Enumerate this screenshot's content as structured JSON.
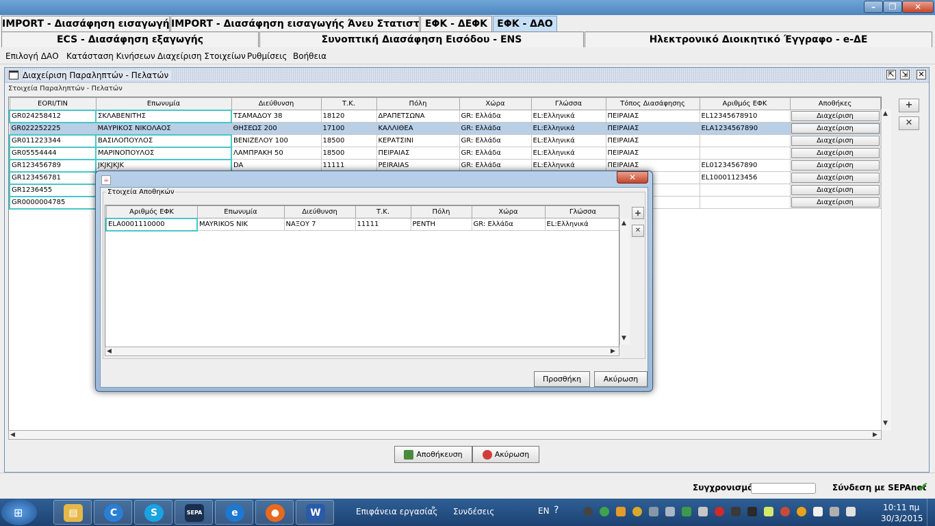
{
  "tabs_row1": [
    {
      "label": "IMPORT - Διασάφηση εισαγωγής",
      "active": false
    },
    {
      "label": "IMPORT - Διασάφηση εισαγωγής Άνευ Στατιστικής",
      "active": false
    },
    {
      "label": "ΕΦΚ - ΔΕΦΚ",
      "active": false
    },
    {
      "label": "ΕΦΚ - ΔΑΟ",
      "active": true
    }
  ],
  "tabs_row2": [
    {
      "label": "ECS - Διασάφηση εξαγωγής"
    },
    {
      "label": "Συνοπτική Διασάφηση Εισόδου - ENS"
    },
    {
      "label": "Ηλεκτρονικό Διοικητικό Έγγραφο - e-ΔΕ"
    }
  ],
  "menu": [
    "Επιλογή ΔΑΟ",
    "Κατάσταση Κινήσεων",
    "Διαχείριση Στοιχείων",
    "Ρυθμίσεις",
    "Βοήθεια"
  ],
  "frame": {
    "title": "Διαχείριση Παραληπτών - Πελατών",
    "group_label": "Στοιχεία Παραληπτών - Πελατών"
  },
  "table": {
    "headers": [
      "EORI/TIN",
      "Επωνυμία",
      "Διεύθυνση",
      "Τ.Κ.",
      "Πόλη",
      "Χώρα",
      "Γλώσσα",
      "Τόπος Διασάφησης",
      "Αριθμός ΕΦΚ",
      "Αποθήκες"
    ],
    "button_label": "Διαχείριση",
    "rows": [
      [
        "GR024258412",
        "ΣΚΛΑΒΕΝΙΤΗΣ",
        "ΤΣΑΜΑΔΟΥ 38",
        "18120",
        "ΔΡΑΠΕΤΣΩΝΑ",
        "GR: Ελλάδα",
        "EL:Ελληνικά",
        "ΠΕΙΡΑΙΑΣ",
        "EL12345678910"
      ],
      [
        "GR022252225",
        "ΜΑΥΡΙΚΟΣ ΝΙΚΟΛΑΟΣ",
        "ΘΗΣΕΩΣ 200",
        "17100",
        "ΚΑΛΛΙΘΕΑ",
        "GR: Ελλάδα",
        "EL:Ελληνικά",
        "ΠΕΙΡΑΙΑΣ",
        "ELA1234567890"
      ],
      [
        "GR011223344",
        "ΒΑΣΙΛΟΠΟΥΛΟΣ",
        "ΒΕΝΙΖΕΛΟΥ 100",
        "18500",
        "ΚΕΡΑΤΣΙΝΙ",
        "GR: Ελλάδα",
        "EL:Ελληνικά",
        "ΠΕΙΡΑΙΑΣ",
        ""
      ],
      [
        "GR05554444",
        "ΜΑΡΙΝΟΠΟΥΛΟΣ",
        "ΛΑΜΠΡΑΚΗ 50",
        "18500",
        "ΠΕΙΡΑΙΑΣ",
        "GR: Ελλάδα",
        "EL:Ελληνικά",
        "ΠΕΙΡΑΙΑΣ",
        ""
      ],
      [
        "GR123456789",
        "JKJKJKJK",
        "DA",
        "11111",
        "PEIRAIAS",
        "GR: Ελλάδα",
        "EL:Ελληνικά",
        "ΠΕΙΡΑΙΑΣ",
        "EL01234567890"
      ],
      [
        "GR123456781",
        "",
        "",
        "",
        "",
        "",
        "",
        "",
        "EL10001123456"
      ],
      [
        "GR1236455",
        "",
        "",
        "",
        "",
        "",
        "",
        "",
        ""
      ],
      [
        "GR0000004785",
        "",
        "",
        "",
        "",
        "",
        "",
        "",
        ""
      ]
    ]
  },
  "buttons": {
    "save": "Αποθήκευση",
    "cancel": "Ακύρωση"
  },
  "status": {
    "sync_label": "Συγχρονισμός",
    "sepanet_label": "Σύνδεση με SEPAnet"
  },
  "dialog": {
    "group_label": "Στοιχεία Αποθηκών",
    "headers": [
      "Αριθμός ΕΦΚ",
      "Επωνυμία",
      "Διεύθυνση",
      "Τ.Κ.",
      "Πόλη",
      "Χώρα",
      "Γλώσσα"
    ],
    "rows": [
      [
        "ELA0001110000",
        "MAYRIKOS NIK",
        "ΝΑΞΟΥ 7",
        "11111",
        "ΡΕΝΤΗ",
        "GR: Ελλάδα",
        "EL:Ελληνικά"
      ]
    ],
    "add_button": "Προσθήκη",
    "cancel_button": "Ακύρωση"
  },
  "taskbar": {
    "desktop_label": "Επιφάνεια εργασίας",
    "links_label": "Συνδέσεις",
    "lang": "EN",
    "time": "10:11 πμ",
    "date": "30/3/2015",
    "sepa_app_label": "SEPA"
  },
  "colors": {
    "accent": "#c6dff7",
    "selection": "#b8cfe6",
    "cell_focus": "#46c6c9",
    "taskbar": "#1d4272"
  }
}
